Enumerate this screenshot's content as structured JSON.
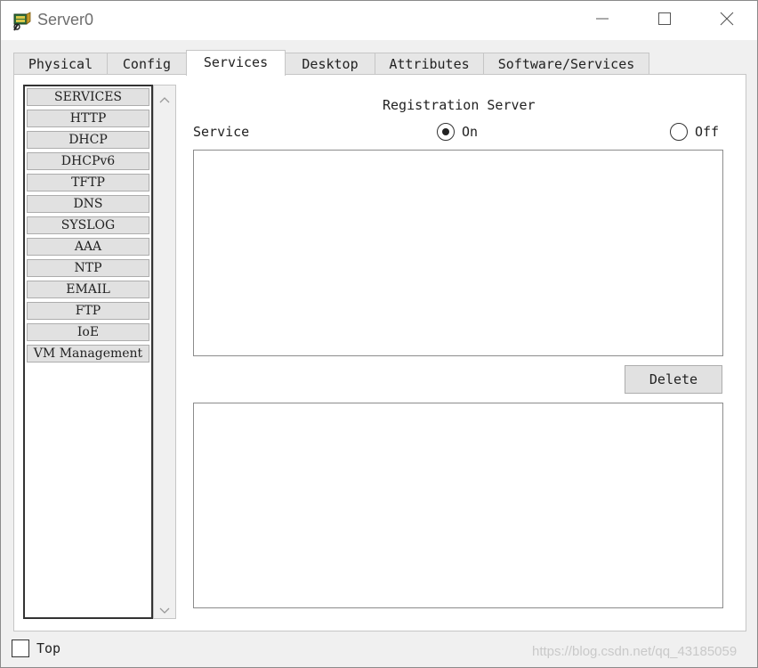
{
  "window": {
    "title": "Server0",
    "icon": "server-app-icon",
    "controls": [
      "minimize-icon",
      "maximize-icon",
      "close-icon"
    ]
  },
  "tabs": [
    {
      "label": "Physical",
      "active": false
    },
    {
      "label": "Config",
      "active": false
    },
    {
      "label": "Services",
      "active": true
    },
    {
      "label": "Desktop",
      "active": false
    },
    {
      "label": "Attributes",
      "active": false
    },
    {
      "label": "Software/Services",
      "active": false
    }
  ],
  "services_list": {
    "items": [
      "SERVICES",
      "HTTP",
      "DHCP",
      "DHCPv6",
      "TFTP",
      "DNS",
      "SYSLOG",
      "AAA",
      "NTP",
      "EMAIL",
      "FTP",
      "IoE",
      "VM Management"
    ]
  },
  "main": {
    "section_title": "Registration Server",
    "service_label": "Service",
    "radio_on_label": "On",
    "radio_off_label": "Off",
    "selected": "On",
    "delete_label": "Delete"
  },
  "footer": {
    "top_label": "Top",
    "top_checked": false,
    "watermark": "https://blog.csdn.net/qq_43185059"
  },
  "colors": {
    "window_bg": "#f0f0f0",
    "panel_bg": "#ffffff",
    "button_bg": "#e1e1e1",
    "border": "#adadad"
  }
}
